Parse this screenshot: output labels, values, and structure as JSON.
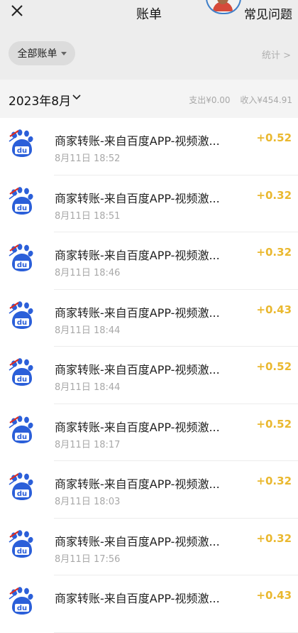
{
  "header": {
    "title": "账单",
    "help_label": "常见问题"
  },
  "filter": {
    "label": "全部账单",
    "stats_label": "统计 >"
  },
  "month": {
    "label": "2023年8月",
    "expense": "支出¥0.00",
    "income": "收入¥454.91"
  },
  "colors": {
    "amount": "#eab82f",
    "baidu_blue": "#2b5fd9",
    "baidu_red": "#e02d20"
  },
  "transactions": [
    {
      "title": "商家转账-来自百度APP-视频激...",
      "time": "8月11日 18:52",
      "amount": "+0.52"
    },
    {
      "title": "商家转账-来自百度APP-视频激...",
      "time": "8月11日 18:51",
      "amount": "+0.32"
    },
    {
      "title": "商家转账-来自百度APP-视频激...",
      "time": "8月11日 18:46",
      "amount": "+0.32"
    },
    {
      "title": "商家转账-来自百度APP-视频激...",
      "time": "8月11日 18:44",
      "amount": "+0.43"
    },
    {
      "title": "商家转账-来自百度APP-视频激...",
      "time": "8月11日 18:44",
      "amount": "+0.52"
    },
    {
      "title": "商家转账-来自百度APP-视频激...",
      "time": "8月11日 18:17",
      "amount": "+0.52"
    },
    {
      "title": "商家转账-来自百度APP-视频激...",
      "time": "8月11日 18:03",
      "amount": "+0.32"
    },
    {
      "title": "商家转账-来自百度APP-视频激...",
      "time": "8月11日 17:56",
      "amount": "+0.32"
    },
    {
      "title": "商家转账-来自百度APP-视频激...",
      "time": "",
      "amount": "+0.43"
    }
  ]
}
